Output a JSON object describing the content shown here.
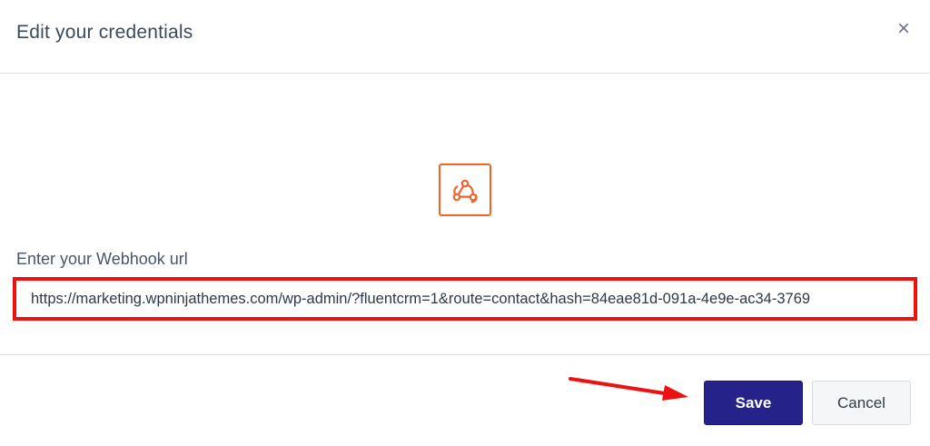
{
  "dialog": {
    "title": "Edit your credentials",
    "close_icon": "close-icon",
    "close_glyph": "×"
  },
  "integration": {
    "icon": "webhook-icon",
    "accent_color": "#f0642c"
  },
  "webhook_field": {
    "label": "Enter your Webhook url",
    "value": "https://marketing.wpninjathemes.com/wp-admin/?fluentcrm=1&route=contact&hash=84eae81d-091a-4e9e-ac34-3769",
    "highlight_color": "#ee1111"
  },
  "footer": {
    "save_label": "Save",
    "cancel_label": "Cancel",
    "save_color": "#25228a",
    "annotation_arrow_color": "#ee1111"
  }
}
